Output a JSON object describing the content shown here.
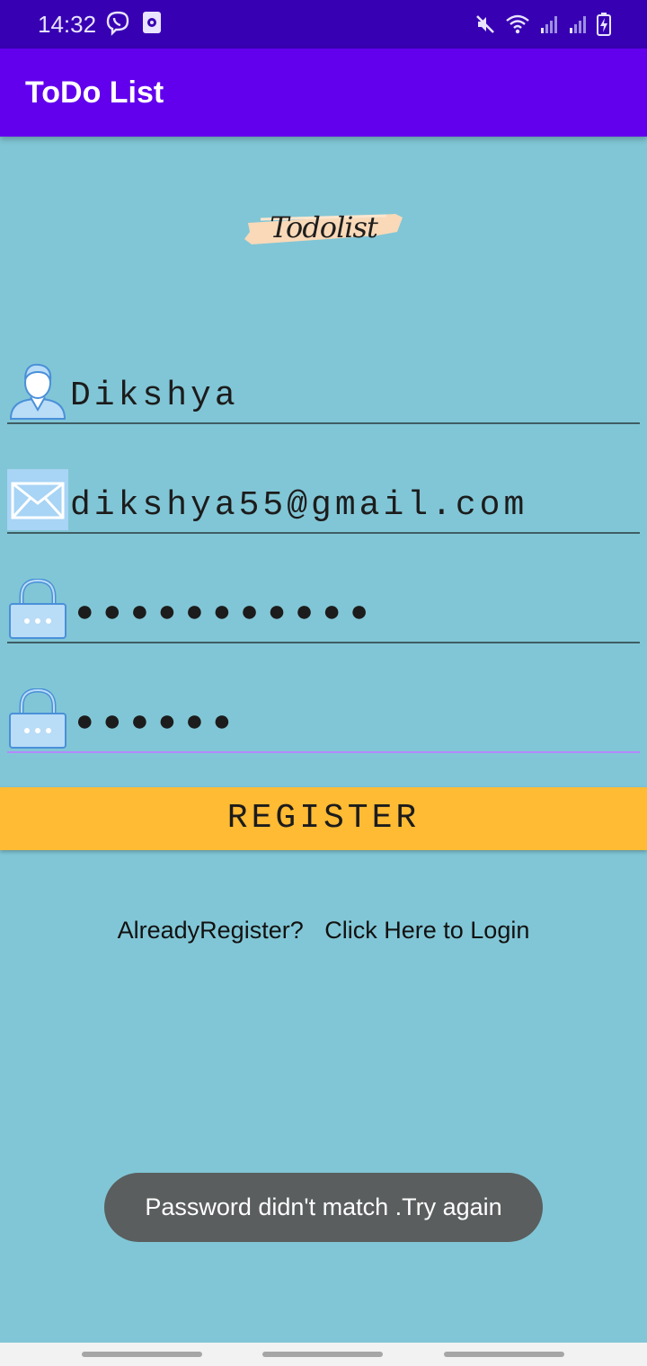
{
  "status_bar": {
    "time": "14:32",
    "left_icons": [
      "viber-icon",
      "screen-record-icon"
    ],
    "right_icons": [
      "mute-icon",
      "wifi-icon",
      "signal-icon",
      "signal-icon",
      "battery-charging-icon"
    ]
  },
  "app_bar": {
    "title": "ToDo List",
    "color": "#6200ee"
  },
  "logo": {
    "text": "Todolist"
  },
  "form": {
    "username": {
      "icon": "user-icon",
      "value": "Dikshya"
    },
    "email": {
      "icon": "mail-icon",
      "value": "dikshya55@gmail.com"
    },
    "password": {
      "icon": "lock-icon",
      "value": "●●●●●●●●●●●"
    },
    "confirm_password": {
      "icon": "lock-icon",
      "value": "●●●●●●"
    }
  },
  "register_button": {
    "label": "REGISTER",
    "color": "#ffbb33"
  },
  "login_prompt": {
    "question": "AlreadyRegister?",
    "link": "Click Here to Login"
  },
  "toast": {
    "message": "Password didn't match .Try again"
  }
}
